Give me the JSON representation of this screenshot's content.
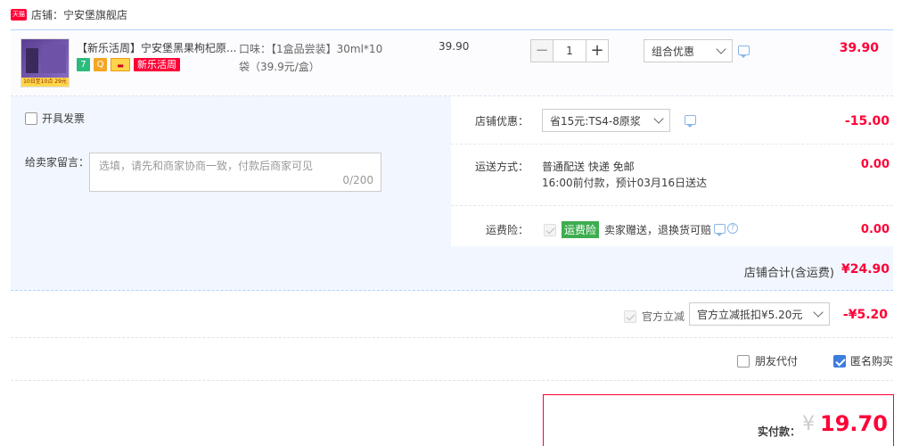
{
  "shop": {
    "badge": "天猫",
    "label": "店铺：宁安堡旗舰店"
  },
  "item": {
    "thumb_strip": "10日至10点 29元",
    "title": "【新乐活周】宁安堡黑果枸杞原...",
    "tags": {
      "t7": "7",
      "tq": "Q",
      "tc": "▬",
      "promo": "新乐活周"
    },
    "sku_line1": "口味：【1盒品尝装】30ml*10",
    "sku_line2": "袋（39.9元/盒）",
    "unit_price": "39.90",
    "qty_minus": "−",
    "qty_value": "1",
    "qty_plus": "+",
    "combo_select": "组合优惠",
    "row_total": "39.90"
  },
  "invoice": {
    "label": "开具发票",
    "checked": false
  },
  "message": {
    "label": "给卖家留言：",
    "placeholder": "选填，请先和商家协商一致，付款后商家可见",
    "count": "0/200"
  },
  "store_discount": {
    "label": "店铺优惠：",
    "select": "省15元:TS4-8原浆",
    "value": "-15.00"
  },
  "shipping": {
    "label": "运送方式：",
    "line1": "普通配送 快递 免邮",
    "line2": "16:00前付款，预计03月16日送达",
    "value": "0.00"
  },
  "insurance": {
    "label": "运费险：",
    "badge": "运费险",
    "text": "卖家赠送，退换货可赔",
    "q": "?",
    "value": "0.00"
  },
  "subtotal": {
    "label": "店铺合计(含运费)",
    "value": "¥24.90"
  },
  "official": {
    "label": "官方立减",
    "select": "官方立减抵扣¥5.20元",
    "value": "-¥5.20"
  },
  "options": {
    "friend_pay": "朋友代付",
    "anonymous": "匿名购买"
  },
  "pay": {
    "label": "实付款：",
    "currency": "¥",
    "amount": "19.70"
  }
}
